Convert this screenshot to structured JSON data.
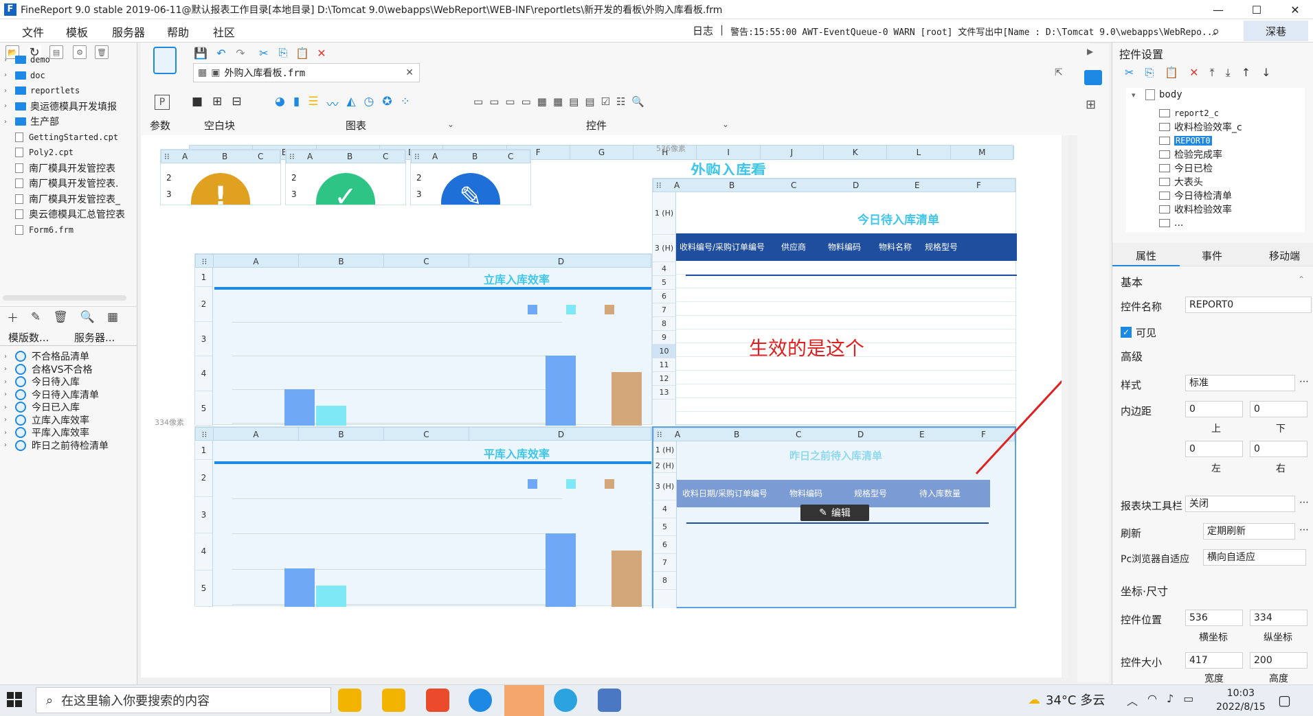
{
  "window": {
    "title": "FineReport 9.0 stable 2019-06-11@默认报表工作目录[本地目录]    D:\\Tomcat 9.0\\webapps\\WebReport\\WEB-INF\\reportlets\\新开发的看板\\外购入库看板.frm",
    "minimize": "—",
    "maximize": "☐",
    "close": "✕"
  },
  "menu": {
    "items": [
      "文件",
      "模板",
      "服务器",
      "帮助",
      "社区"
    ],
    "log_label": "日志",
    "log_message": "警告:15:55:00 AWT-EventQueue-0 WARN [root] 文件写出中[Name : D:\\Tomcat 9.0\\webapps\\WebRepo...",
    "user": "深巷"
  },
  "left_tree": {
    "items": [
      {
        "label": "demo",
        "type": "folder",
        "mono": true
      },
      {
        "label": "doc",
        "type": "folder",
        "mono": true
      },
      {
        "label": "reportlets",
        "type": "folder",
        "mono": true
      },
      {
        "label": "奥运德模具开发填报",
        "type": "folder",
        "mono": false
      },
      {
        "label": "生产部",
        "type": "folder",
        "mono": false
      },
      {
        "label": "GettingStarted.cpt",
        "type": "file",
        "mono": true
      },
      {
        "label": "Poly2.cpt",
        "type": "file",
        "mono": true
      },
      {
        "label": "南厂模具开发管控表",
        "type": "file",
        "mono": false
      },
      {
        "label": "南厂模具开发管控表.",
        "type": "file",
        "mono": false
      },
      {
        "label": "南厂模具开发管控表_",
        "type": "file",
        "mono": false
      },
      {
        "label": "奥云德模具汇总管控表",
        "type": "file",
        "mono": false
      },
      {
        "label": "Form6.frm",
        "type": "file",
        "mono": true
      }
    ],
    "tabs": [
      "模版数...",
      "服务器..."
    ],
    "datasets": [
      "不合格品清单",
      "合格VS不合格",
      "今日待入库",
      "今日待入库清单",
      "今日已入库",
      "立库入库效率",
      "平库入库效率",
      "昨日之前待检清单"
    ]
  },
  "editor": {
    "tab_label": "外购入库看板.frm",
    "group_params": "参数",
    "group_blank": "空白块",
    "group_chart": "图表",
    "group_widget": "控件"
  },
  "canvas": {
    "col_letters": [
      "A",
      "B",
      "C",
      "D",
      "E",
      "F",
      "G",
      "H",
      "I",
      "J",
      "K",
      "L",
      "M"
    ],
    "pixel_tag_1": "536像素",
    "pixel_tag_2": "334像素",
    "top_title": "外购入库看板",
    "block1_title": "立库入库效率",
    "block2_title": "平库入库效率",
    "block3_title": "今日待入库清单",
    "block4_title": "昨日之前待入库清单",
    "block3_headers": [
      "收料编号/采购订单编号",
      "供应商",
      "物料编码",
      "物料名称",
      "规格型号"
    ],
    "block4_headers": [
      "收料日期/采购订单编号",
      "物料编码",
      "规格型号",
      "待入库数量"
    ],
    "annotation": "生效的是这个",
    "edit_button": "编辑",
    "row_labels_left": [
      "1",
      "2",
      "3",
      "4",
      "5"
    ],
    "row_labels_right": [
      "1 (H)",
      "3 (H)",
      "4",
      "5",
      "6",
      "7",
      "8",
      "9",
      "10",
      "11",
      "12",
      "13"
    ],
    "row_labels_bottom_right": [
      "1 (H)",
      "2 (H)",
      "3 (H)",
      "4",
      "5",
      "6",
      "7",
      "8"
    ]
  },
  "right_panel": {
    "header": "控件设置",
    "tree_root": "body",
    "components": [
      "report2_c",
      "收料检验效率_c",
      "REPORT0",
      "检验完成率",
      "今日已检",
      "大表头",
      "今日待检清单",
      "收料检验效率",
      "..."
    ],
    "selected_component": "REPORT0",
    "tabs": [
      "属性",
      "事件",
      "移动端"
    ],
    "section_basic": "基本",
    "label_name": "控件名称",
    "value_name": "REPORT0",
    "label_visible": "可见",
    "section_advanced": "高级",
    "label_style": "样式",
    "value_style": "标准",
    "label_padding": "内边距",
    "pad_top": "0",
    "pad_bottom": "0",
    "pad_left": "0",
    "pad_right": "0",
    "cap_top": "上",
    "cap_bottom": "下",
    "cap_left": "左",
    "cap_right": "右",
    "label_toolbar": "报表块工具栏",
    "value_toolbar": "关闭",
    "label_refresh": "刷新",
    "value_refresh": "定期刷新",
    "label_adapt": "Pc浏览器自适应",
    "value_adapt": "横向自适应",
    "section_coord": "坐标·尺寸",
    "label_pos": "控件位置",
    "pos_x": "536",
    "pos_y": "334",
    "cap_x": "横坐标",
    "cap_y": "纵坐标",
    "label_size": "控件大小",
    "size_w": "417",
    "size_h": "200",
    "cap_w": "宽度",
    "cap_h": "高度"
  },
  "taskbar": {
    "search_placeholder": "在这里输入你要搜索的内容",
    "weather": "34°C 多云",
    "time": "10:03",
    "date": "2022/8/15"
  },
  "colors": {
    "header_blue": "#1f4e9e",
    "cyan_title": "#3fc6e8",
    "bar_blue": "#6fa8f5",
    "bar_cyan": "#7ee8f7",
    "bar_tan": "#d4a77a",
    "annotation_red": "#e02020"
  }
}
